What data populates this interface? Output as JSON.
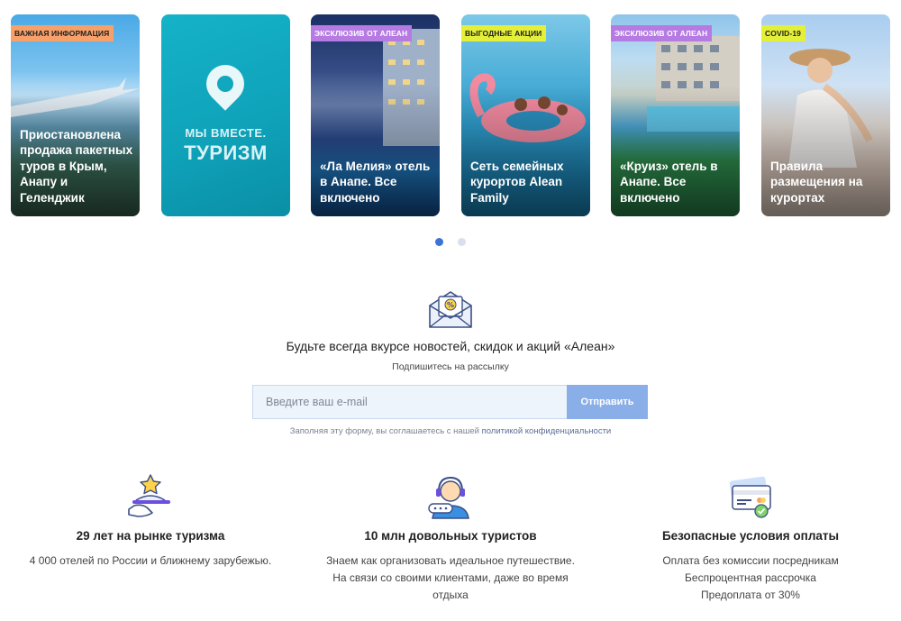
{
  "stories": [
    {
      "badge": "Важная информация",
      "badge_color": "#f7a06a",
      "title": "Приостановлена продажа пакетных туров в Крым, Анапу и Геленджик"
    },
    {
      "badge": "",
      "brand_line1": "МЫ ВМЕСТЕ.",
      "brand_line2": "ТУРИЗМ",
      "title": ""
    },
    {
      "badge": "Эксклюзив от Алеан",
      "badge_color": "#b57be3",
      "title": "«Ла Мелия» отель в Анапе. Все включено"
    },
    {
      "badge": "Выгодные акции",
      "badge_color": "#e4ef3a",
      "title": "Сеть семейных курортов Alean Family"
    },
    {
      "badge": "Эксклюзив от Алеан",
      "badge_color": "#b57be3",
      "title": "«Круиз» отель в Анапе. Все включено"
    },
    {
      "badge": "Covid-19",
      "badge_color": "#e4ef3a",
      "title": "Правила размещения на курортах"
    }
  ],
  "carousel": {
    "active_index": 1,
    "total": 2
  },
  "subscribe": {
    "title": "Будьте всегда вкурсе новостей, скидок и акций «Алеан»",
    "subtitle": "Подпишитесь на рассылку",
    "email_placeholder": "Введите ваш e-mail",
    "button_label": "Отправить",
    "consent_text": "Заполняя эту форму, вы соглашаетесь с нашей ",
    "consent_link": "политикой конфиденциальности"
  },
  "features": [
    {
      "icon": "serving-tray-star-icon",
      "title": "29 лет на рынке туризма",
      "lines": [
        "4 000 отелей по России и ближнему зарубежью."
      ]
    },
    {
      "icon": "support-operator-icon",
      "title": "10 млн довольных туристов",
      "lines": [
        "Знаем как организовать идеальное путешествие.",
        "На связи со своими клиентами, даже во время",
        "отдыха"
      ]
    },
    {
      "icon": "secure-payment-card-icon",
      "title": "Безопасные условия оплаты",
      "lines": [
        "Оплата без комиссии посредникам",
        "Беспроцентная рассрочка",
        "Предоплата от 30%"
      ]
    }
  ],
  "colors": {
    "accent": "#3b73d9",
    "button": "#8aaee8",
    "teal": "#11a7bd"
  }
}
